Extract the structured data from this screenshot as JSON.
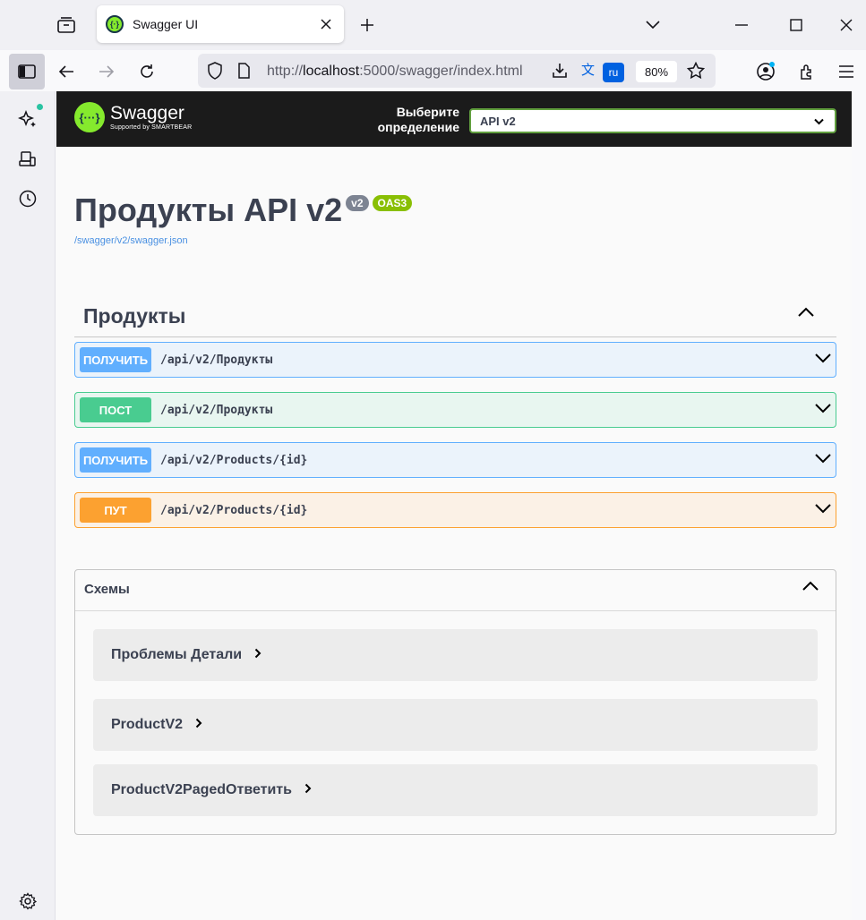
{
  "browser": {
    "tab_title": "Swagger UI",
    "url_prefix": "http://",
    "url_host": "localhost",
    "url_rest": ":5000/swagger/index.html",
    "translate_lang": "ru",
    "zoom": "80%"
  },
  "swagger": {
    "logo_name": "Swagger",
    "logo_sub": "Supported by SMARTBEAR",
    "definition_label": "Выберите определение",
    "definition_value": "API v2",
    "title": "Продукты API v2",
    "version_badge": "v2",
    "oas_badge": "OAS3",
    "spec_link": "/swagger/v2/swagger.json"
  },
  "tag": {
    "name": "Продукты"
  },
  "operations": [
    {
      "method": "ПОЛУЧИТЬ",
      "path": "/api/v2/Продукты",
      "kind": "get"
    },
    {
      "method": "ПОСТ",
      "path": "/api/v2/Продукты",
      "kind": "post"
    },
    {
      "method": "ПОЛУЧИТЬ",
      "path": "/api/v2/Products/{id}",
      "kind": "get"
    },
    {
      "method": "ПУТ",
      "path": "/api/v2/Products/{id}",
      "kind": "put"
    }
  ],
  "schemas": {
    "title": "Схемы",
    "models": [
      "Проблемы Детали",
      "ProductV2",
      "ProductV2PagedОтветить"
    ]
  },
  "colors": {
    "get": "#61affe",
    "post": "#49cc90",
    "put": "#fca130",
    "swagger_green": "#85ea2d"
  }
}
